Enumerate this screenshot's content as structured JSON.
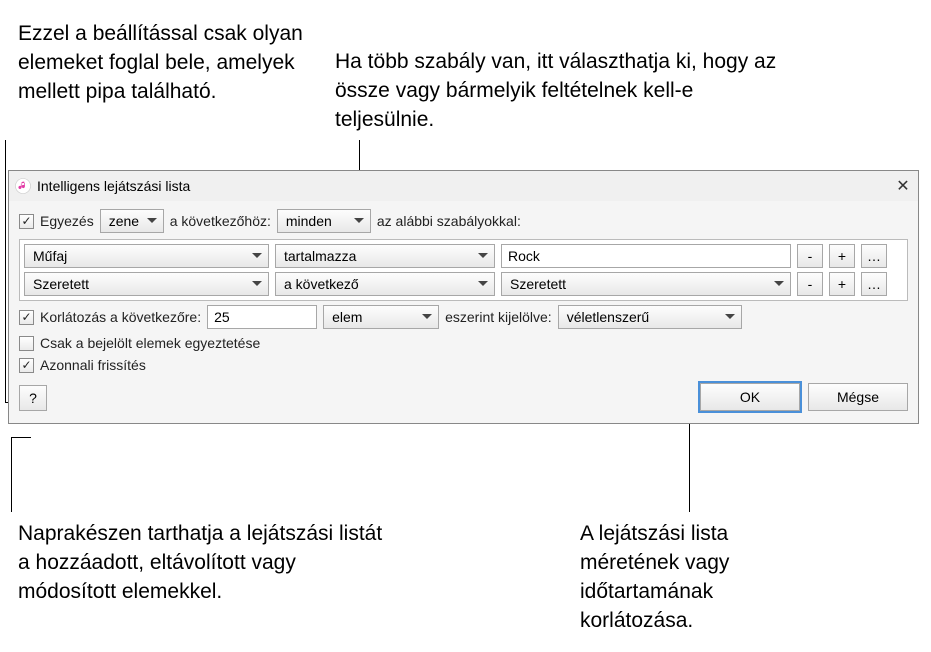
{
  "callouts": {
    "topLeft": "Ezzel a beállítással csak olyan elemeket foglal bele, amelyek mellett pipa található.",
    "topRight": "Ha több szabály van, itt választhatja ki, hogy az össze vagy bármelyik feltételnek kell-e teljesülnie.",
    "bottomLeft": "Naprakészen tarthatja a lejátszási listát a hozzáadott, eltávolított vagy módosított elemekkel.",
    "bottomRight": "A lejátszási lista méretének vagy időtartamának korlátozása."
  },
  "dialog": {
    "title": "Intelligens lejátszási lista",
    "matchRow": {
      "matchCheckboxLabel": "Egyezés",
      "mediaSelect": "zene",
      "joinLabel": "a következőhöz:",
      "conditionSelect": "minden",
      "trailingLabel": "az alábbi szabályokkal:"
    },
    "rules": [
      {
        "field": "Műfaj",
        "operator": "tartalmazza",
        "valueType": "text",
        "value": "Rock"
      },
      {
        "field": "Szeretett",
        "operator": "a következő",
        "valueType": "select",
        "value": "Szeretett"
      }
    ],
    "ruleButtons": {
      "minus": "-",
      "plus": "+",
      "more": "…"
    },
    "limit": {
      "checkboxLabel": "Korlátozás a következőre:",
      "amount": "25",
      "unit": "elem",
      "selectedByLabel": "eszerint kijelölve:",
      "selectedBy": "véletlenszerű"
    },
    "onlyChecked": "Csak a bejelölt elemek egyeztetése",
    "liveUpdate": "Azonnali frissítés",
    "help": "?",
    "buttons": {
      "ok": "OK",
      "cancel": "Mégse"
    }
  }
}
